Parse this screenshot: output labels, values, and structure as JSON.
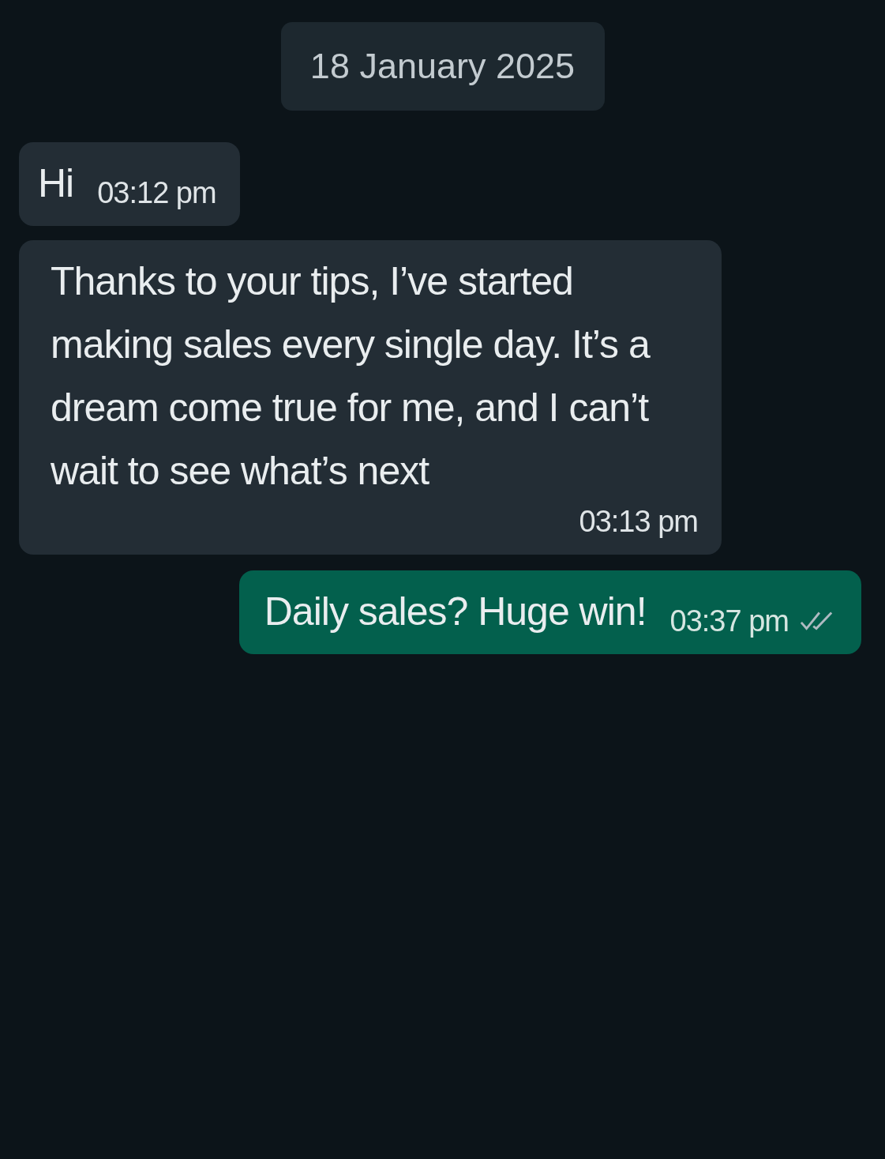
{
  "date_chip": "18 January 2025",
  "messages": [
    {
      "kind": "incoming",
      "text": "Hi",
      "time": "03:12 pm"
    },
    {
      "kind": "incoming",
      "text": "Thanks to your tips, I’ve started making sales every single day. It’s a dream come true for me, and I can’t wait to see what’s next",
      "time": "03:13 pm"
    },
    {
      "kind": "outgoing",
      "text": "Daily sales? Huge win!",
      "time": "03:37 pm",
      "read": false
    }
  ]
}
